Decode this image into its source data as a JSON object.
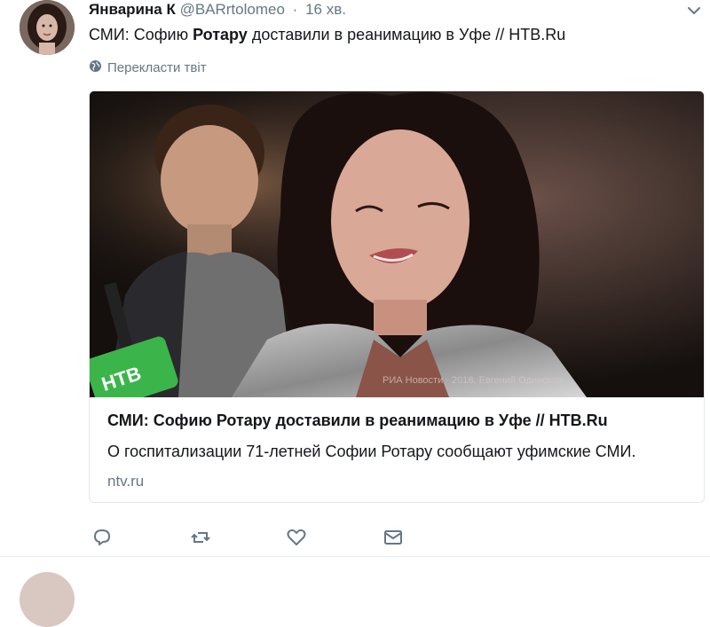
{
  "tweet": {
    "name": "Январина К",
    "handle": "@BARrtolomeo",
    "separator": "·",
    "time": "16 хв.",
    "text_before": "СМИ: Софию ",
    "text_bold": "Ротару",
    "text_after": " доставили в реанимацию в Уфе // НТВ.Ru",
    "translate_label": "Перекласти твіт"
  },
  "card": {
    "image_caption": "РИА Новости · 2018, Евгений Одиноков",
    "logo_text": "НТВ",
    "title": "СМИ: Софию Ротару доставили в реанимацию в Уфе // НТВ.Ru",
    "description": "О госпитализации 71-летней Софии Ротару сообщают уфимские СМИ.",
    "domain": "ntv.ru"
  },
  "icons": {
    "reply": "reply-icon",
    "retweet": "retweet-icon",
    "like": "heart-icon",
    "message": "envelope-icon",
    "more": "chevron-down-icon",
    "translate": "globe-icon"
  },
  "colors": {
    "text": "#14171a",
    "secondary": "#657786",
    "border": "#e1e8ed",
    "ntv_green": "#3bb54a"
  }
}
